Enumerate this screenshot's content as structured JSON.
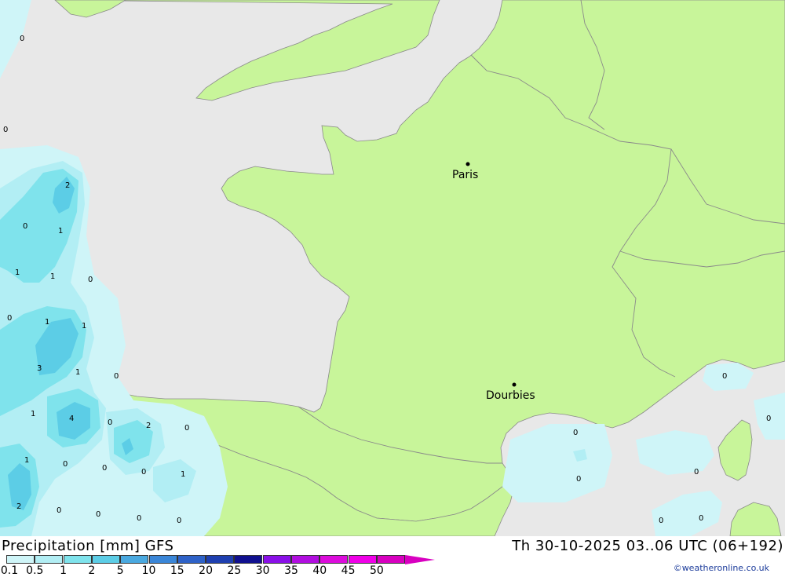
{
  "map": {
    "cities": [
      {
        "name": "Paris"
      },
      {
        "name": "Dourbies"
      }
    ],
    "precip_labels": [
      "0",
      "0",
      "2",
      "0",
      "1",
      "1",
      "1",
      "0",
      "0",
      "1",
      "1",
      "3",
      "1",
      "0",
      "1",
      "4",
      "0",
      "2",
      "0",
      "1",
      "0",
      "0",
      "0",
      "1",
      "2",
      "0",
      "0",
      "0",
      "0",
      "0",
      "0",
      "0",
      "0",
      "0",
      "0",
      "0"
    ]
  },
  "footer": {
    "title": "Precipitation [mm] GFS",
    "valid": "Th 30-10-2025 03..06 UTC (06+192)",
    "credit": "©weatheronline.co.uk"
  },
  "legend": {
    "ticks": [
      "0.1",
      "0.5",
      "1",
      "2",
      "5",
      "10",
      "15",
      "20",
      "25",
      "30",
      "35",
      "40",
      "45",
      "50"
    ],
    "colors": [
      "#cff5f8",
      "#b2eef4",
      "#7fe3ec",
      "#5ccde6",
      "#4aa9e0",
      "#3a86d8",
      "#2e62c8",
      "#1e3fb0",
      "#10108f",
      "#8a10e8",
      "#b10ee0",
      "#dc0cdc",
      "#f000e8",
      "#d800c0"
    ]
  }
}
